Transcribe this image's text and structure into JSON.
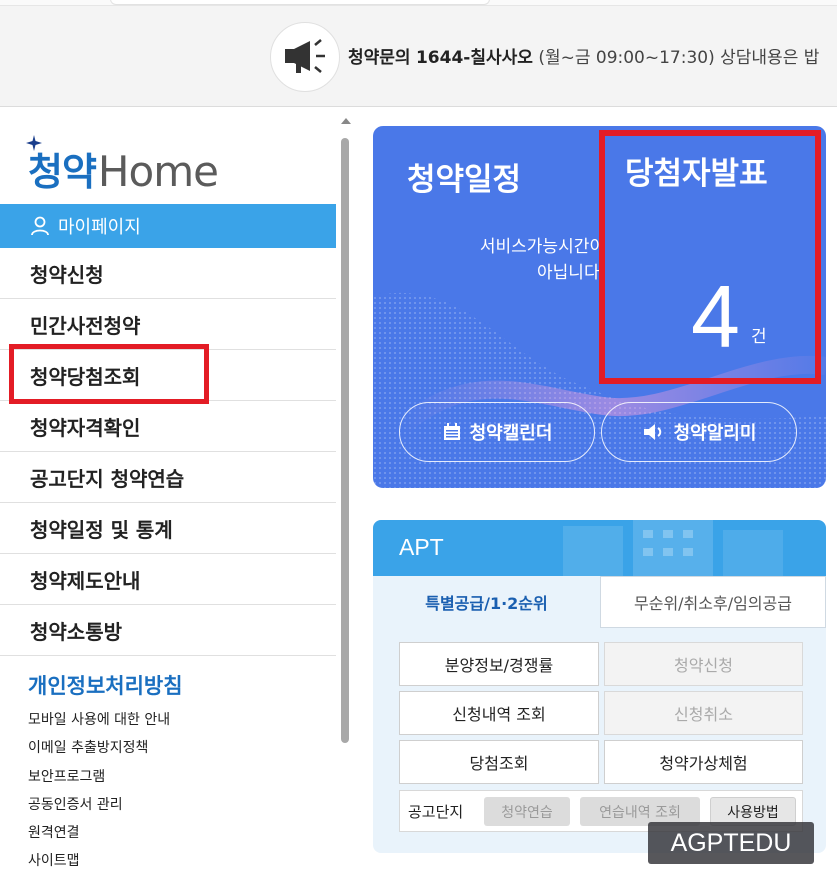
{
  "notice": {
    "label": "청약문의",
    "phone": "1644-칠사사오",
    "hours": "(월~금 09:00~17:30)",
    "extra": "상담내용은 밥"
  },
  "logo": {
    "ko": "청약",
    "en": "Home"
  },
  "nav": {
    "mypage": "마이페이지",
    "items": [
      "청약신청",
      "민간사전청약",
      "청약당첨조회",
      "청약자격확인",
      "공고단지 청약연습",
      "청약일정 및 통계",
      "청약제도안내",
      "청약소통방"
    ],
    "privacy": "개인정보처리방침",
    "sublinks": [
      "모바일 사용에 대한 안내",
      "이메일 추출방지정책",
      "보안프로그램",
      "공동인증서 관리",
      "원격연결",
      "사이트맵"
    ]
  },
  "schedule": {
    "title": "청약일정",
    "message": "서비스가능시간이\n아닙니다.",
    "winner_title": "당첨자발표",
    "winner_count": "4",
    "winner_unit": "건",
    "calendar_button": "청약캘린더",
    "alarm_button": "청약알리미"
  },
  "apt": {
    "title": "APT",
    "tabs": [
      "특별공급/1·2순위",
      "무순위/취소후/임의공급"
    ],
    "buttons": [
      "분양정보/경쟁률",
      "청약신청",
      "신청내역 조회",
      "신청취소",
      "당첨조회",
      "청약가상체험"
    ],
    "complex_label": "공고단지",
    "complex_buttons": [
      "청약연습",
      "연습내역 조회",
      "사용방법"
    ]
  },
  "watermark": "AGPTEDU",
  "colors": {
    "primary_blue": "#4a78e8",
    "sky_blue": "#3aa3e8",
    "highlight_red": "#e31c25",
    "brand_blue": "#1a6fc0"
  }
}
